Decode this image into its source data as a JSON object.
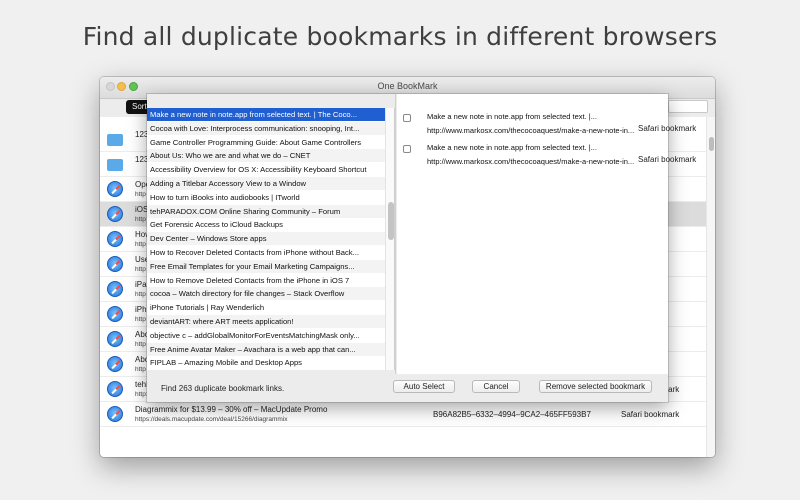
{
  "headline": "Find all duplicate bookmarks in different browsers",
  "window": {
    "title": "One BookMark",
    "sort_label": "Sort"
  },
  "background_rows": [
    {
      "icon": "folder-icon",
      "title": "123",
      "url": "",
      "id": "",
      "kind": ""
    },
    {
      "icon": "folder-icon",
      "title": "123",
      "url": "",
      "id": "",
      "kind": ""
    },
    {
      "icon": "safari-icon",
      "title": "Ope",
      "url": "http",
      "id": "",
      "kind": "",
      "selected": false
    },
    {
      "icon": "safari-icon",
      "title": "iOS",
      "url": "http",
      "id": "",
      "kind": "",
      "selected": true
    },
    {
      "icon": "safari-icon",
      "title": "How",
      "url": "http",
      "id": "",
      "kind": ""
    },
    {
      "icon": "safari-icon",
      "title": "Use",
      "url": "http",
      "id": "",
      "kind": ""
    },
    {
      "icon": "safari-icon",
      "title": "iPa",
      "url": "http",
      "id": "",
      "kind": ""
    },
    {
      "icon": "safari-icon",
      "title": "iPh",
      "url": "http",
      "id": "",
      "kind": ""
    },
    {
      "icon": "safari-icon",
      "title": "Abo",
      "url": "http",
      "id": "",
      "kind": ""
    },
    {
      "icon": "safari-icon",
      "title": "Abo",
      "url": "http",
      "id": "",
      "kind": ""
    },
    {
      "icon": "safari-icon",
      "title": "tehPARADOX.COM Online Sharing Community – Forum",
      "url": "http://tehparadox.com/forum/",
      "id": "CDBAEB73–4D62–4D43–B6BC–",
      "kind": "Safari bookmark"
    },
    {
      "icon": "safari-icon",
      "title": "Diagrammix for $13.99 – 30% off – MacUpdate Promo",
      "url": "https://deals.macupdate.com/deal/15266/diagrammix",
      "id": "B96A82B5–6332–4994–9CA2–465FF593B7",
      "kind": "Safari bookmark"
    }
  ],
  "duplicate_list": [
    "Make a new note in note.app from selected text. | The Coco...",
    "Cocoa with Love: Interprocess communication: snooping, Int...",
    "Game Controller Programming Guide: About Game Controllers",
    "About Us: Who we are and what we do – CNET",
    "Accessibility Overview for OS X: Accessibility Keyboard Shortcut",
    "Adding a Titlebar Accessory View to a Window",
    "How to turn iBooks into audiobooks | ITworld",
    "tehPARADOX.COM Online Sharing Community – Forum",
    "Get Forensic Access to iCloud Backups",
    "Dev Center – Windows Store apps",
    "How to Recover Deleted Contacts from iPhone without Back...",
    "Free Email Templates for your Email Marketing Campaigns...",
    "How to Remove Deleted Contacts from the iPhone in iOS 7",
    "cocoa – Watch directory for file changes – Stack Overflow",
    "iPhone Tutorials | Ray Wenderlich",
    "deviantART: where ART meets application!",
    "objective c – addGlobalMonitorForEventsMatchingMask only...",
    "Free Anime Avatar Maker – Avachara is a web app that can...",
    "FIPLAB – Amazing Mobile and Desktop Apps"
  ],
  "duplicate_entries": [
    {
      "title": "Make a new note in note.app from selected text. |...",
      "url": "http://www.markosx.com/thecocoaquest/make-a-new-note-in...",
      "kind": "Safari bookmark"
    },
    {
      "title": "Make a new note in note.app from selected text. |...",
      "url": "http://www.markosx.com/thecocoaquest/make-a-new-note-in...",
      "kind": "Safari bookmark"
    }
  ],
  "footer": {
    "found_text": "Find 263 duplicate bookmark links.",
    "auto_select": "Auto Select",
    "cancel": "Cancel",
    "remove": "Remove selected bookmark"
  },
  "colors": {
    "selection": "#1f5fd1",
    "folder": "#5aa9e8"
  }
}
